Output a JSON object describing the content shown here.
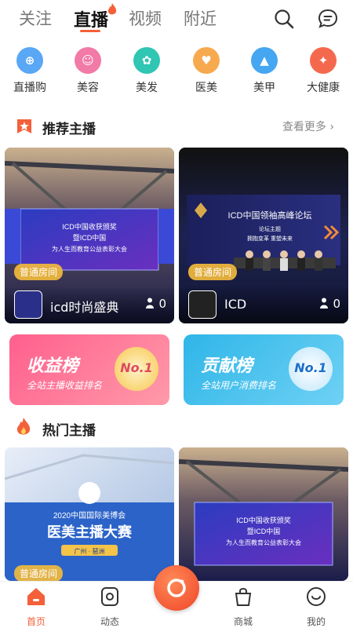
{
  "top_tabs": [
    "关注",
    "直播",
    "视频",
    "附近"
  ],
  "top_icons": [
    "search-icon",
    "message-icon"
  ],
  "categories": [
    {
      "label": "直播购",
      "color": "#5aa7f5",
      "icon": "shopping-cart-icon"
    },
    {
      "label": "美容",
      "color": "#f27aa6",
      "icon": "face-icon"
    },
    {
      "label": "美发",
      "color": "#2fc6b3",
      "icon": "hair-icon"
    },
    {
      "label": "医美",
      "color": "#f7a94f",
      "icon": "heart-icon"
    },
    {
      "label": "美甲",
      "color": "#45a6f2",
      "icon": "nail-icon"
    },
    {
      "label": "大健康",
      "color": "#f4694e",
      "icon": "runner-icon"
    }
  ],
  "recommended": {
    "title": "推荐主播",
    "more": "查看更多",
    "cards": [
      {
        "tag": "普通房间",
        "name": "icd时尚盛典",
        "viewers": "0",
        "screen": [
          "ICD中国收获颁奖",
          "暨ICD中国",
          "为人生而教育公益表彰大会"
        ]
      },
      {
        "tag": "普通房间",
        "name": "ICD",
        "viewers": "0",
        "screen": [
          "ICD中国领袖高峰论坛",
          "论坛主题",
          "拥抱变革  重塑未来"
        ]
      }
    ]
  },
  "banners": [
    {
      "title": "收益榜",
      "subtitle": "全站主播收益排名",
      "badge": "No.1",
      "colors": [
        "#ff5f8d",
        "#ff9aa9"
      ]
    },
    {
      "title": "贡献榜",
      "subtitle": "全站用户消费排名",
      "badge": "No.1",
      "colors": [
        "#2fb6e8",
        "#6fd1f4"
      ]
    }
  ],
  "hot": {
    "title": "热门主播",
    "cards": [
      {
        "tag": "普通房间",
        "screen": [
          "2020中国国际美博会",
          "医美主播大赛",
          "广州 · 琶洲"
        ]
      },
      {
        "tag": "",
        "screen": [
          "ICD中国收获颁奖",
          "暨ICD中国",
          "为人生而教育公益表彰大会"
        ]
      }
    ]
  },
  "nav": [
    "首页",
    "动态",
    "商城",
    "我的"
  ],
  "colors": {
    "accent": "#f3603a",
    "tag": "#f2ba3c"
  }
}
